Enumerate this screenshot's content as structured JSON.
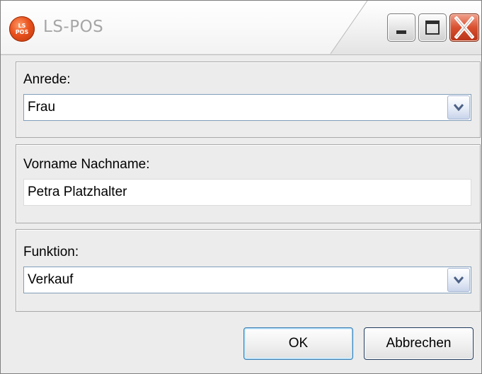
{
  "window": {
    "title": "LS-POS",
    "icon_text_top": "LS",
    "icon_text_bottom": "POS",
    "controls": {
      "minimize": "minimize-icon",
      "maximize": "maximize-icon",
      "close": "close-icon"
    }
  },
  "form": {
    "salutation": {
      "label": "Anrede:",
      "selected": "Frau"
    },
    "fullname": {
      "label": "Vorname Nachname:",
      "value": "Petra Platzhalter"
    },
    "function": {
      "label": "Funktion:",
      "selected": "Verkauf"
    }
  },
  "buttons": {
    "ok_label": "OK",
    "cancel_label": "Abbrechen"
  },
  "colors": {
    "title_text": "#a6a6a6",
    "close_button": "#d8502f",
    "field_border": "#7f9db9",
    "dialog_background": "#ececec"
  }
}
